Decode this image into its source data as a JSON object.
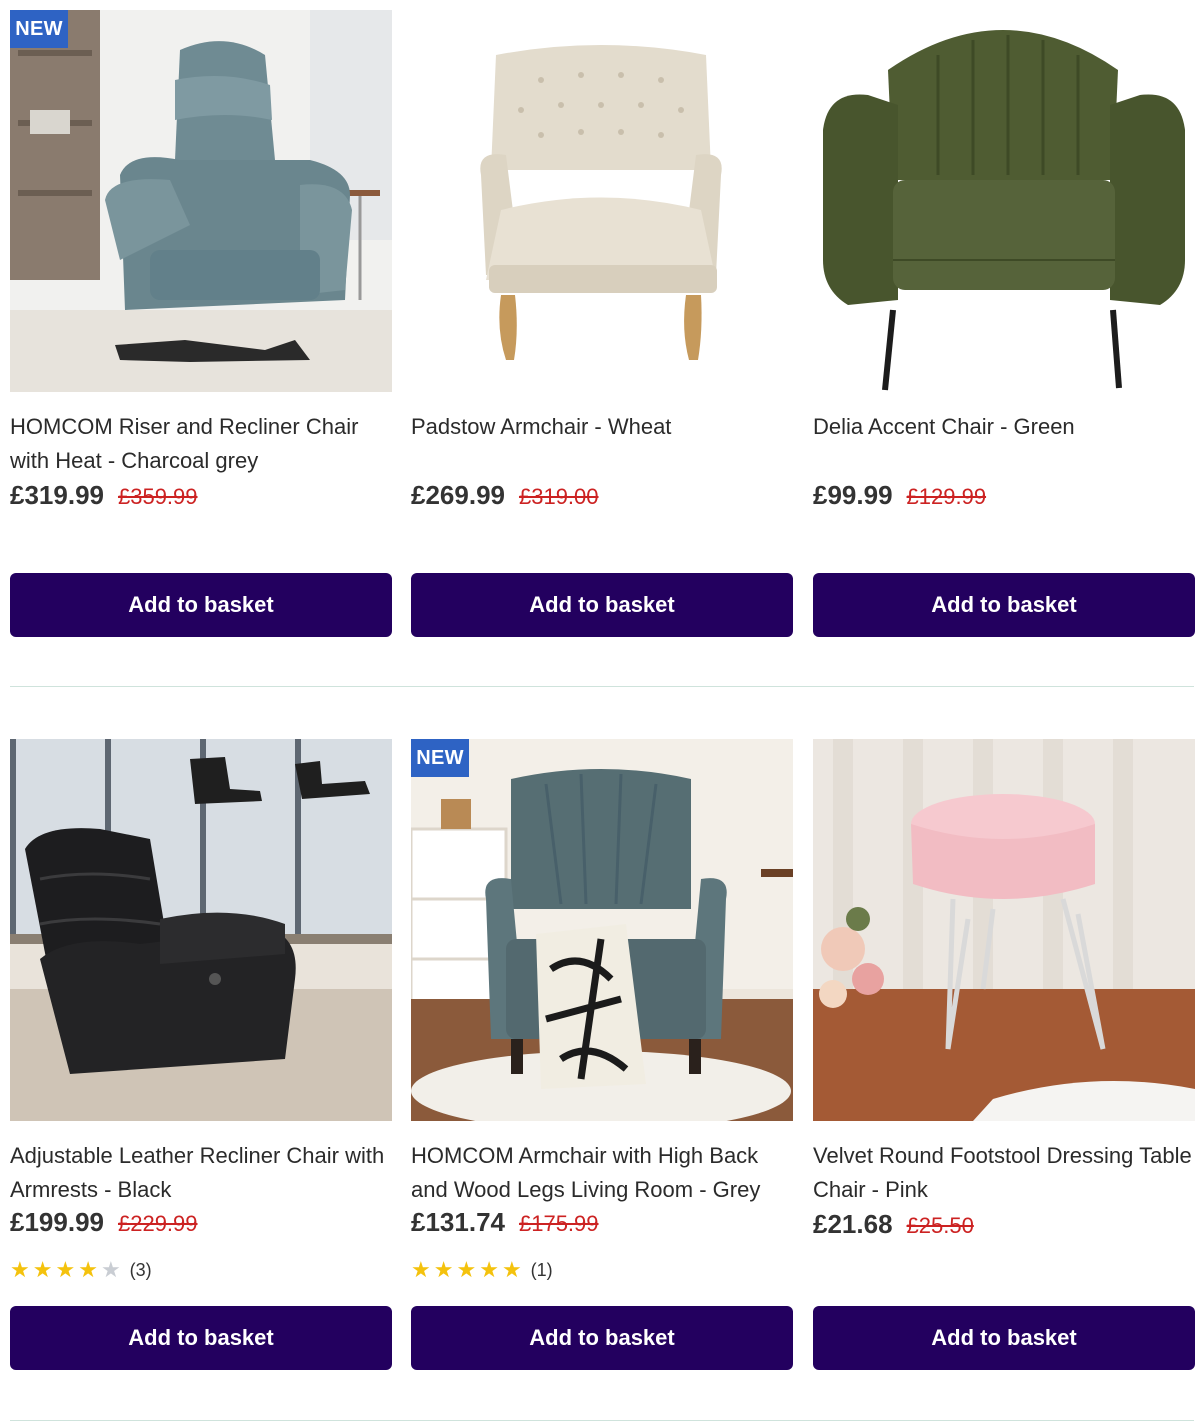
{
  "products": [
    {
      "badge": "NEW",
      "title": "HOMCOM Riser and Recliner Chair with Heat - Charcoal grey",
      "price": "£319.99",
      "was_price": "£359.99",
      "button_label": "Add to basket"
    },
    {
      "badge": "",
      "title": "Padstow Armchair - Wheat",
      "price": "£269.99",
      "was_price": "£319.00",
      "button_label": "Add to basket"
    },
    {
      "badge": "",
      "title": "Delia Accent Chair - Green",
      "price": "£99.99",
      "was_price": "£129.99",
      "button_label": "Add to basket"
    },
    {
      "badge": "",
      "title": "Adjustable Leather Recliner Chair with Armrests - Black",
      "price": "£199.99",
      "was_price": "£229.99",
      "rating": 4,
      "rating_count": "(3)",
      "button_label": "Add to basket"
    },
    {
      "badge": "NEW",
      "title": "HOMCOM Armchair with High Back and Wood Legs Living Room - Grey",
      "price": "£131.74",
      "was_price": "£175.99",
      "rating": 5,
      "rating_count": "(1)",
      "button_label": "Add to basket"
    },
    {
      "badge": "",
      "title": "Velvet Round Footstool Dressing Table Chair - Pink",
      "price": "£21.68",
      "was_price": "£25.50",
      "button_label": "Add to basket"
    }
  ],
  "colors": {
    "button_bg": "#23005f",
    "badge_bg": "#2e63c4",
    "was_price": "#cc2222",
    "star_on": "#f4c20d",
    "star_off": "#c9cdd3"
  }
}
